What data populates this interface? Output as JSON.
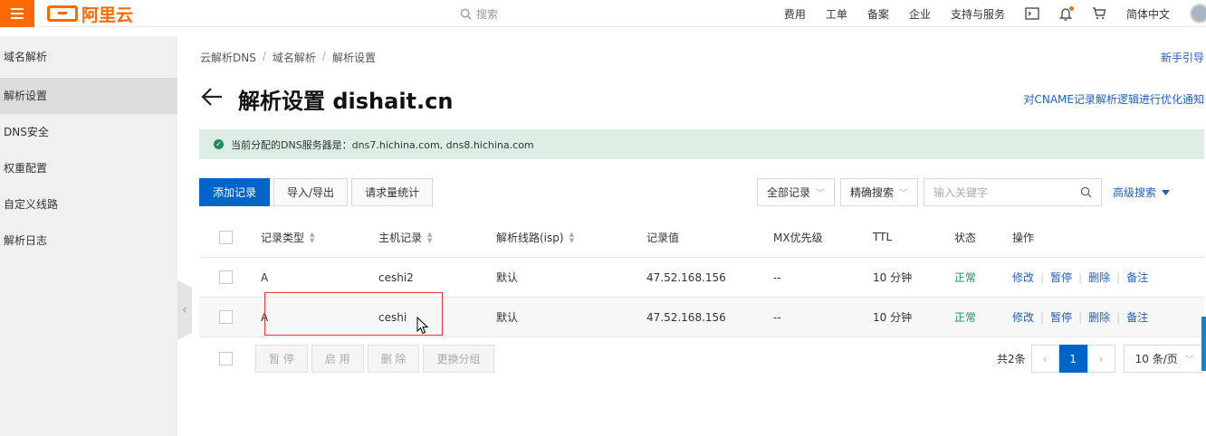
{
  "topbar": {
    "logo_text": "阿里云",
    "search_placeholder": "搜索",
    "nav": [
      "费用",
      "工单",
      "备案",
      "企业",
      "支持与服务"
    ],
    "lang": "简体中文"
  },
  "sidebar": {
    "items": [
      {
        "label": "域名解析",
        "active": false
      },
      {
        "label": "解析设置",
        "active": true
      },
      {
        "label": "DNS安全",
        "active": false
      },
      {
        "label": "权重配置",
        "active": false
      },
      {
        "label": "自定义线路",
        "active": false
      },
      {
        "label": "解析日志",
        "active": false
      }
    ]
  },
  "breadcrumb": [
    "云解析DNS",
    "域名解析",
    "解析设置"
  ],
  "header": {
    "guide_link": "新手引导",
    "title": "解析设置 dishait.cn",
    "notice_link": "对CNAME记录解析逻辑进行优化通知"
  },
  "alert": {
    "text": "当前分配的DNS服务器是：dns7.hichina.com, dns8.hichina.com"
  },
  "toolbar": {
    "add": "添加记录",
    "import_export": "导入/导出",
    "stats": "请求量统计"
  },
  "filters": {
    "record_select": "全部记录",
    "search_mode": "精确搜索",
    "keyword_placeholder": "输入关键字",
    "advanced": "高级搜索"
  },
  "table": {
    "columns": [
      "记录类型",
      "主机记录",
      "解析线路(isp)",
      "记录值",
      "MX优先级",
      "TTL",
      "状态",
      "操作"
    ],
    "rows": [
      {
        "type": "A",
        "host": "ceshi2",
        "line": "默认",
        "value": "47.52.168.156",
        "mx": "--",
        "ttl": "10 分钟",
        "status": "正常"
      },
      {
        "type": "A",
        "host": "ceshi",
        "line": "默认",
        "value": "47.52.168.156",
        "mx": "--",
        "ttl": "10 分钟",
        "status": "正常"
      }
    ],
    "actions": [
      "修改",
      "暂停",
      "删除",
      "备注"
    ]
  },
  "bottom": {
    "pause": "暂 停",
    "enable": "启 用",
    "delete": "删 除",
    "group": "更换分组"
  },
  "pager": {
    "total": "共2条",
    "current_page": "1",
    "page_size": "10 条/页"
  },
  "colors": {
    "accent": "#ff6a00",
    "primary": "#0064c8",
    "success": "#1e8e5f",
    "link": "#1f5ec7"
  }
}
